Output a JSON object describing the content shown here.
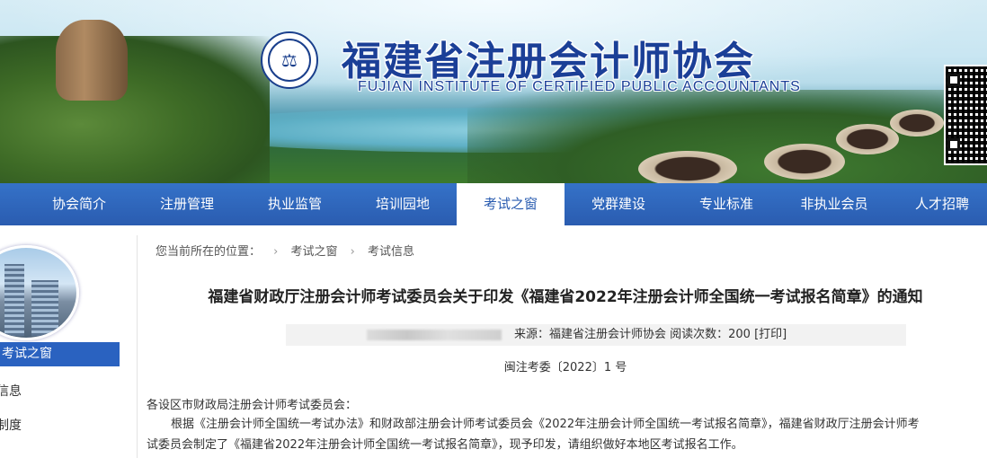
{
  "header": {
    "title_cn": "福建省注册会计师协会",
    "title_en": "FUJIAN INSTITUTE OF CERTIFIED PUBLIC ACCOUNTANTS"
  },
  "nav": {
    "items": [
      {
        "label": "协会简介"
      },
      {
        "label": "注册管理"
      },
      {
        "label": "执业监管"
      },
      {
        "label": "培训园地"
      },
      {
        "label": "考试之窗",
        "active": true
      },
      {
        "label": "党群建设"
      },
      {
        "label": "专业标准"
      },
      {
        "label": "非执业会员"
      },
      {
        "label": "人才招聘"
      }
    ]
  },
  "sidebar": {
    "heading": "考试之窗",
    "links": [
      "信息",
      "制度"
    ]
  },
  "breadcrumb": {
    "prefix": "您当前所在的位置：",
    "items": [
      "考试之窗",
      "考试信息"
    ]
  },
  "article": {
    "title": "福建省财政厅注册会计师考试委员会关于印发《福建省2022年注册会计师全国统一考试报名简章》的通知",
    "meta": "来源：福建省注册会计师协会    阅读次数：200    [打印]",
    "doc_no": "闽注考委〔2022〕1 号",
    "salutation": "各设区市财政局注册会计师考试委员会：",
    "para_line1": "根据《注册会计师全国统一考试办法》和财政部注册会计师考试委员会《2022年注册会计师全国统一考试报名简章》，福建省财政厅注册会计师考",
    "para_line2": "试委员会制定了《福建省2022年注册会计师全国统一考试报名简章》，现予印发，请组织做好本地区考试报名工作。"
  },
  "colors": {
    "nav_bg": "#2a5cb0",
    "title_blue": "#1b3f97",
    "sidebar_head": "#2a62c0"
  }
}
